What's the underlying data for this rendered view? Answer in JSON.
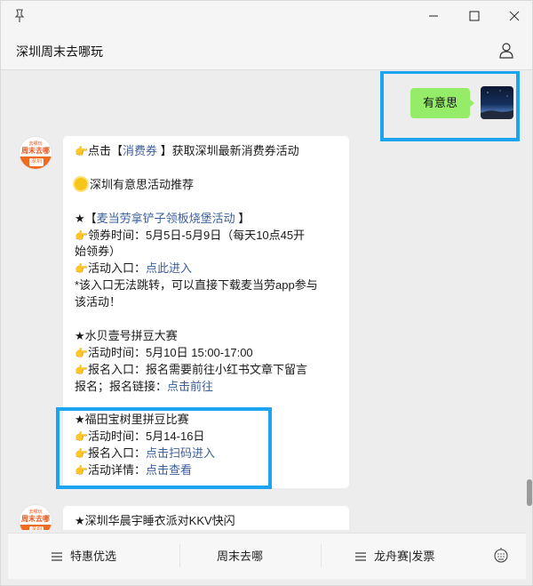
{
  "window": {
    "title": "深圳周末去哪玩"
  },
  "icons": {
    "pin": "pin-icon",
    "minimize": "minimize-icon",
    "maximize": "maximize-icon",
    "close": "close-icon",
    "user": "user-icon",
    "menu": "menu-lines-icon",
    "keyboard": "keyboard-icon"
  },
  "colors": {
    "me_bubble": "#95ec69",
    "link": "#3a5f9c",
    "highlight": "#1da4f0",
    "brand": "#ef6b21"
  },
  "me_message": {
    "text": "有意思"
  },
  "bot_avatar": {
    "line1": "去哪玩",
    "line2": "周末去哪",
    "badge": "深圳"
  },
  "message1": {
    "l1_pre": "点击【",
    "l1_link": "消费券",
    "l1_post": " 】获取深圳最新消费券活动",
    "l2": "深圳有意思活动推荐",
    "l3_pre": "★【",
    "l3_link": "麦当劳拿铲子领板烧堡活动",
    "l3_post": " 】",
    "l4": "领券时间：5月5日-5月9日（每天10点45开",
    "l5": "始领券）",
    "l6_pre": "活动入口：",
    "l6_link": "点此进入",
    "l7": "*该入口无法跳转，可以直接下载麦当劳app参与",
    "l8": "该活动！",
    "l9": "★水贝壹号拼豆大赛",
    "l10": "活动时间：5月10日 15:00-17:00",
    "l11": "报名入口：报名需要前往小红书文章下留言",
    "l12_pre": "报名；报名链接：",
    "l12_link": "点击前往",
    "l13": "★福田宝树里拼豆比赛",
    "l14": "活动时间：5月14-16日",
    "l15_pre": "报名入口：",
    "l15_link": "点击扫码进入",
    "l16_pre": "活动详情：",
    "l16_link": "点击查看"
  },
  "message2": {
    "l1": "★深圳华晨宇睡衣派对KKV快闪"
  },
  "menu": {
    "item1": "特惠优选",
    "item2": "周末去哪",
    "item3": "龙舟赛|发票"
  }
}
